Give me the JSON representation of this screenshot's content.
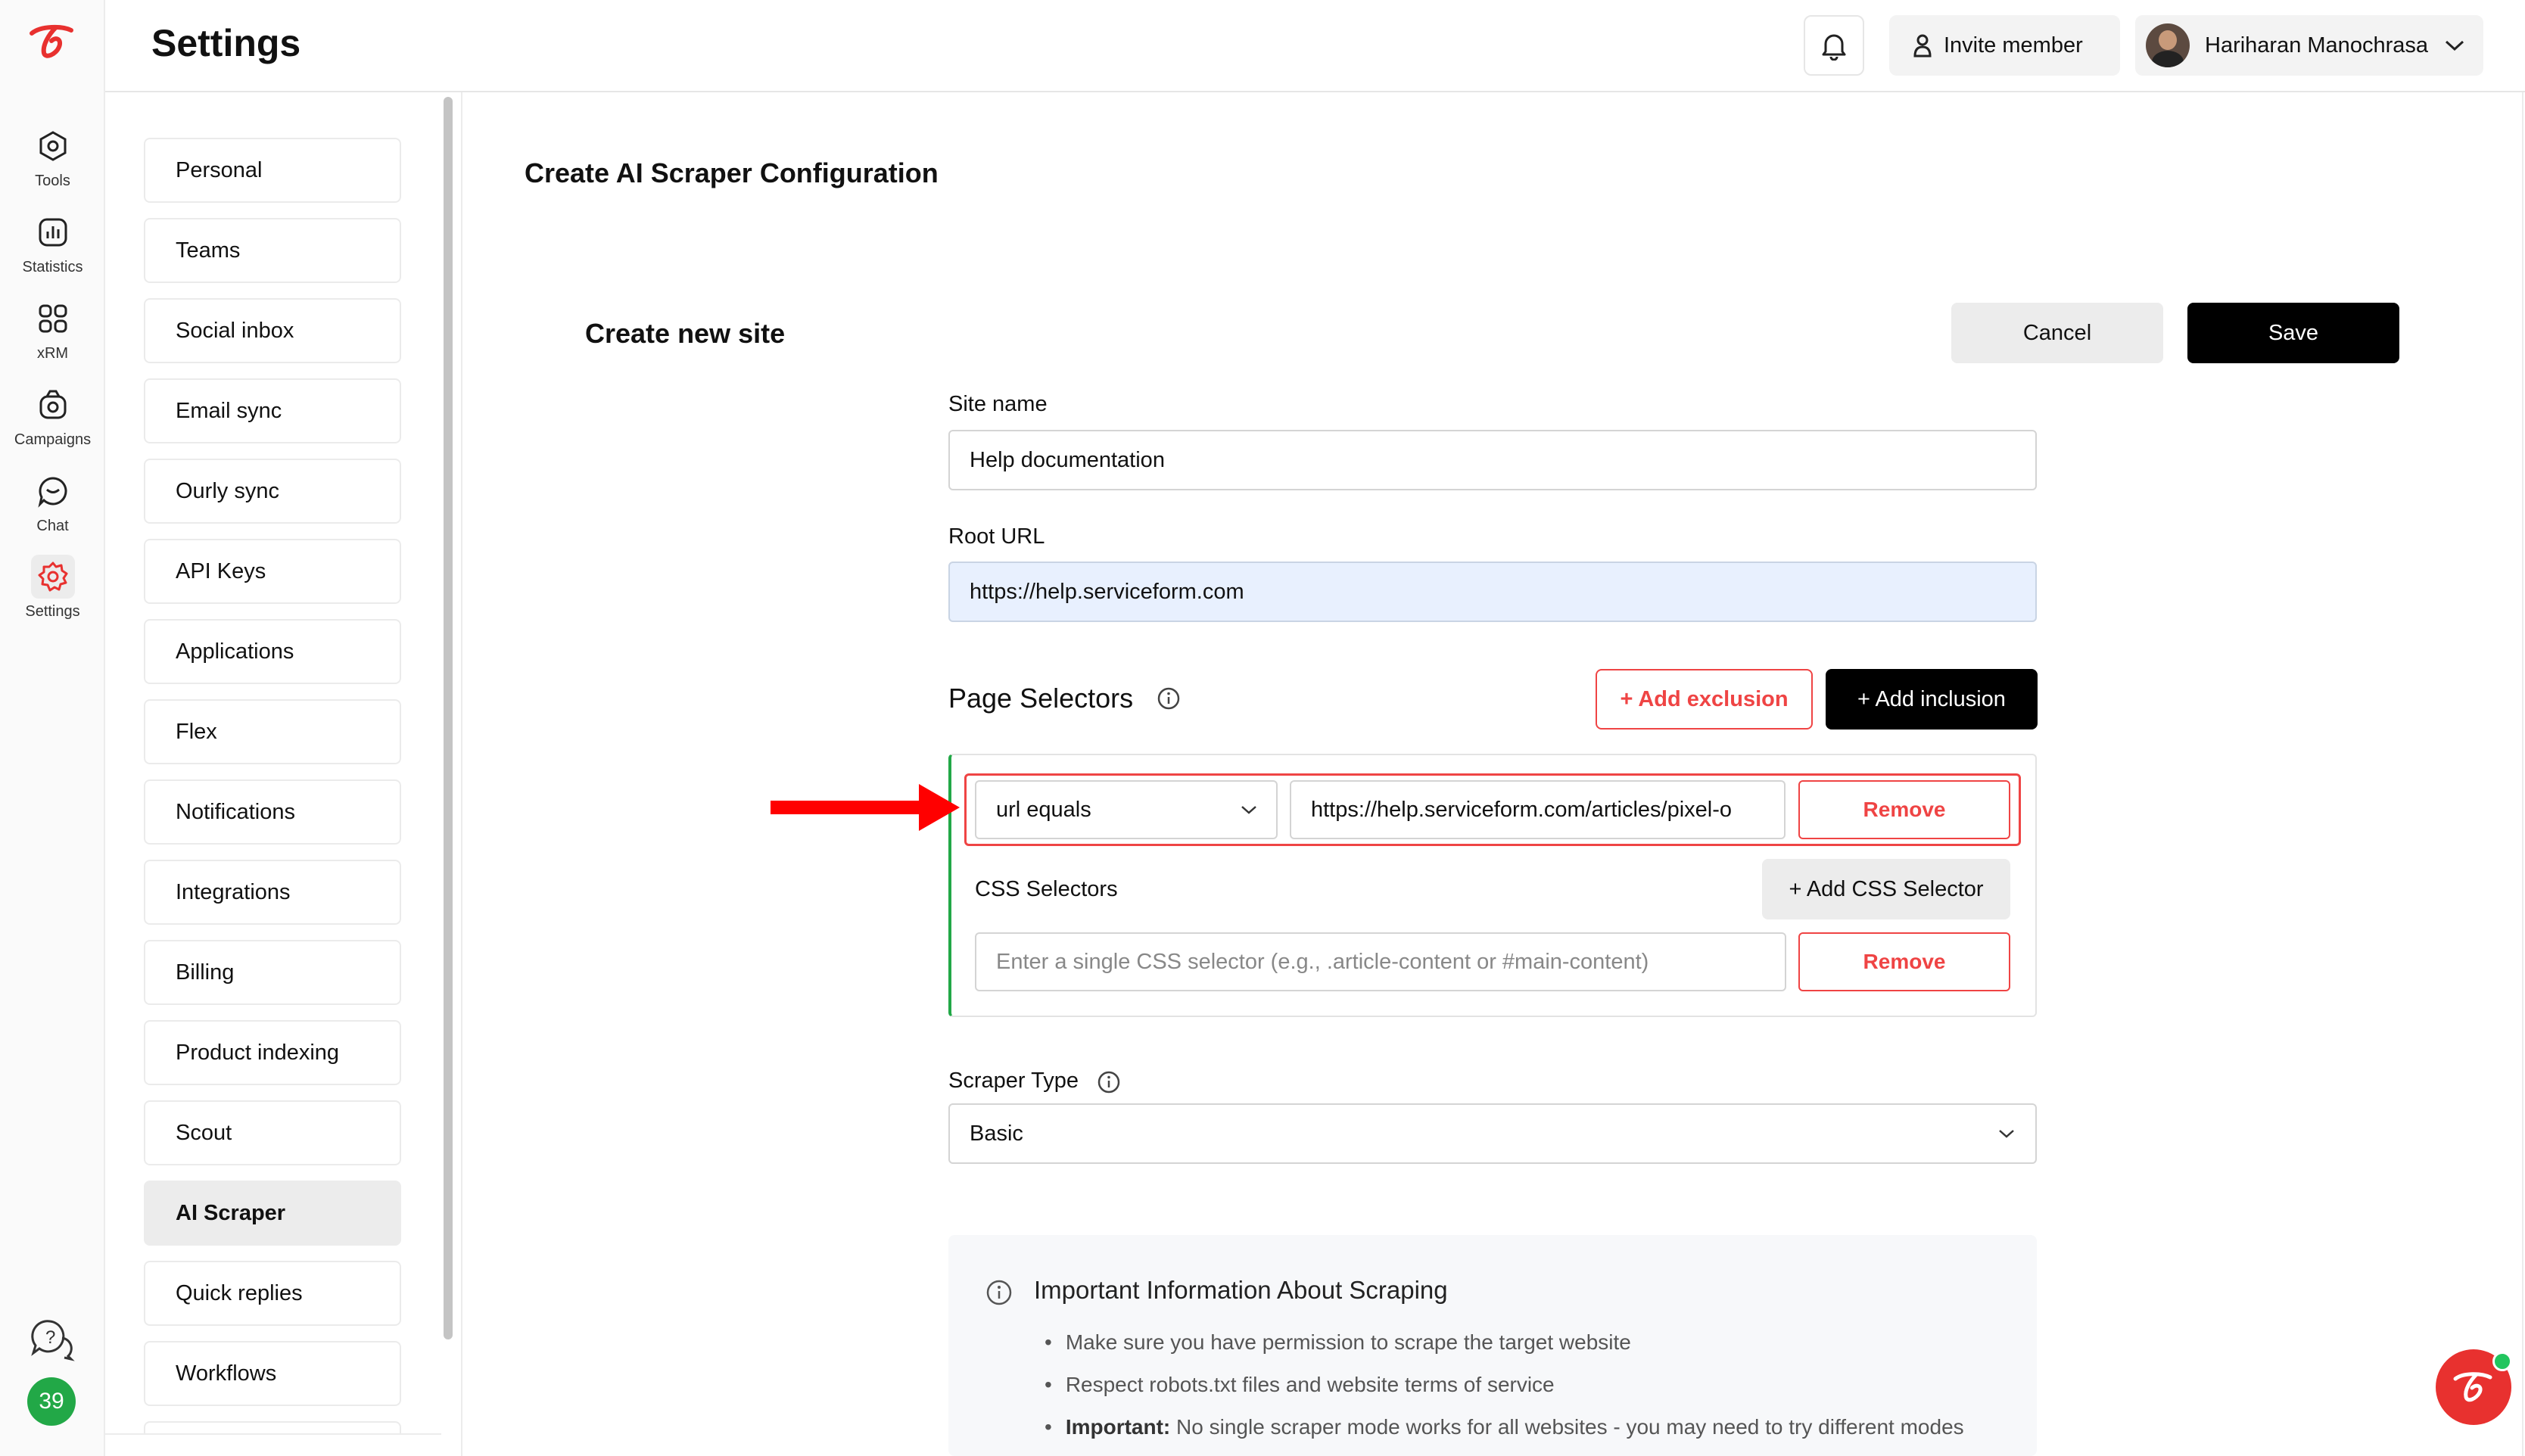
{
  "app": {
    "page_title": "Settings"
  },
  "colors": {
    "accent_red": "#ef4444",
    "brand_red": "#e8312f",
    "green_badge": "#22a847",
    "blue_input": "#e8f0fe"
  },
  "rail": {
    "items": [
      {
        "label": "Tools",
        "icon": "tools-icon"
      },
      {
        "label": "Statistics",
        "icon": "statistics-icon"
      },
      {
        "label": "xRM",
        "icon": "xrm-icon"
      },
      {
        "label": "Campaigns",
        "icon": "campaigns-icon"
      },
      {
        "label": "Chat",
        "icon": "chat-icon"
      },
      {
        "label": "Settings",
        "icon": "gear-icon"
      }
    ],
    "badge_count": "39"
  },
  "header": {
    "invite_label": "Invite member",
    "user_name": "Hariharan Manochrasa"
  },
  "settings_menu": {
    "items": [
      "Personal",
      "Teams",
      "Social inbox",
      "Email sync",
      "Ourly sync",
      "API Keys",
      "Applications",
      "Flex",
      "Notifications",
      "Integrations",
      "Billing",
      "Product indexing",
      "Scout",
      "AI Scraper",
      "Quick replies",
      "Workflows"
    ],
    "active": "AI Scraper"
  },
  "main": {
    "heading": "Create AI Scraper Configuration",
    "form_title": "Create new site",
    "cancel_label": "Cancel",
    "save_label": "Save",
    "site_name_label": "Site name",
    "site_name_value": "Help documentation",
    "root_url_label": "Root URL",
    "root_url_value": "https://help.serviceform.com",
    "page_selectors_title": "Page Selectors",
    "add_exclusion_label": "+ Add exclusion",
    "add_inclusion_label": "+ Add inclusion",
    "selector_match_type": "url equals",
    "selector_url_value": "https://help.serviceform.com/articles/pixel-o",
    "remove_label": "Remove",
    "css_selectors_label": "CSS Selectors",
    "add_css_selector_label": "+ Add CSS Selector",
    "css_selector_placeholder": "Enter a single CSS selector (e.g., .article-content or #main-content)",
    "scraper_type_label": "Scraper Type",
    "scraper_type_value": "Basic",
    "info_title": "Important Information About Scraping",
    "info_bullets": [
      "Make sure you have permission to scrape the target website",
      "Respect robots.txt files and website terms of service"
    ],
    "info_important_prefix": "Important:",
    "info_important_text": " No single scraper mode works for all websites - you may need to try different modes"
  }
}
